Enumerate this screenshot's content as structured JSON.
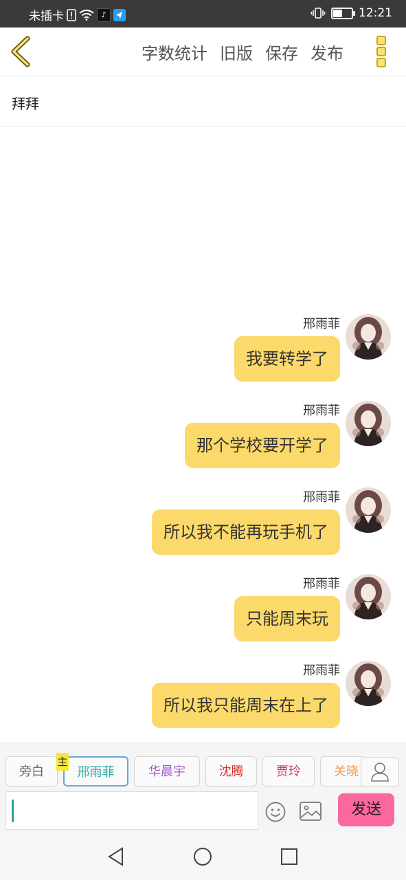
{
  "status_bar": {
    "carrier": "未插卡",
    "time": "12:21",
    "icons": [
      "sim-alert-icon",
      "wifi-icon",
      "tiktok-icon",
      "app-icon",
      "vibrate-icon",
      "battery-icon"
    ],
    "battery_level": 0.55
  },
  "toolbar": {
    "actions": [
      "字数统计",
      "旧版",
      "保存",
      "发布"
    ],
    "back_icon": "chevron-left-icon",
    "more_icon": "more-vertical-icon"
  },
  "title": "拜拜",
  "messages": [
    {
      "name": "邢雨菲",
      "text": "我要转学了"
    },
    {
      "name": "邢雨菲",
      "text": "那个学校要开学了"
    },
    {
      "name": "邢雨菲",
      "text": "所以我不能再玩手机了"
    },
    {
      "name": "邢雨菲",
      "text": "只能周末玩"
    },
    {
      "name": "邢雨菲",
      "text": "所以我只能周末在上了"
    }
  ],
  "roles": [
    {
      "label": "旁白",
      "color": "#666666"
    },
    {
      "label": "邢雨菲",
      "color": "#2aa8a0",
      "active": true
    },
    {
      "label": "华晨宇",
      "color": "#a15bc8"
    },
    {
      "label": "沈腾",
      "color": "#d6302f"
    },
    {
      "label": "贾玲",
      "color": "#d4336f"
    },
    {
      "label": "关晓",
      "color": "#f29a4c"
    }
  ],
  "main_badge": "主",
  "send_label": "发送",
  "colors": {
    "bubble": "#fbd96a",
    "send_button": "#fc67a0",
    "accent": "#f7e17a"
  }
}
